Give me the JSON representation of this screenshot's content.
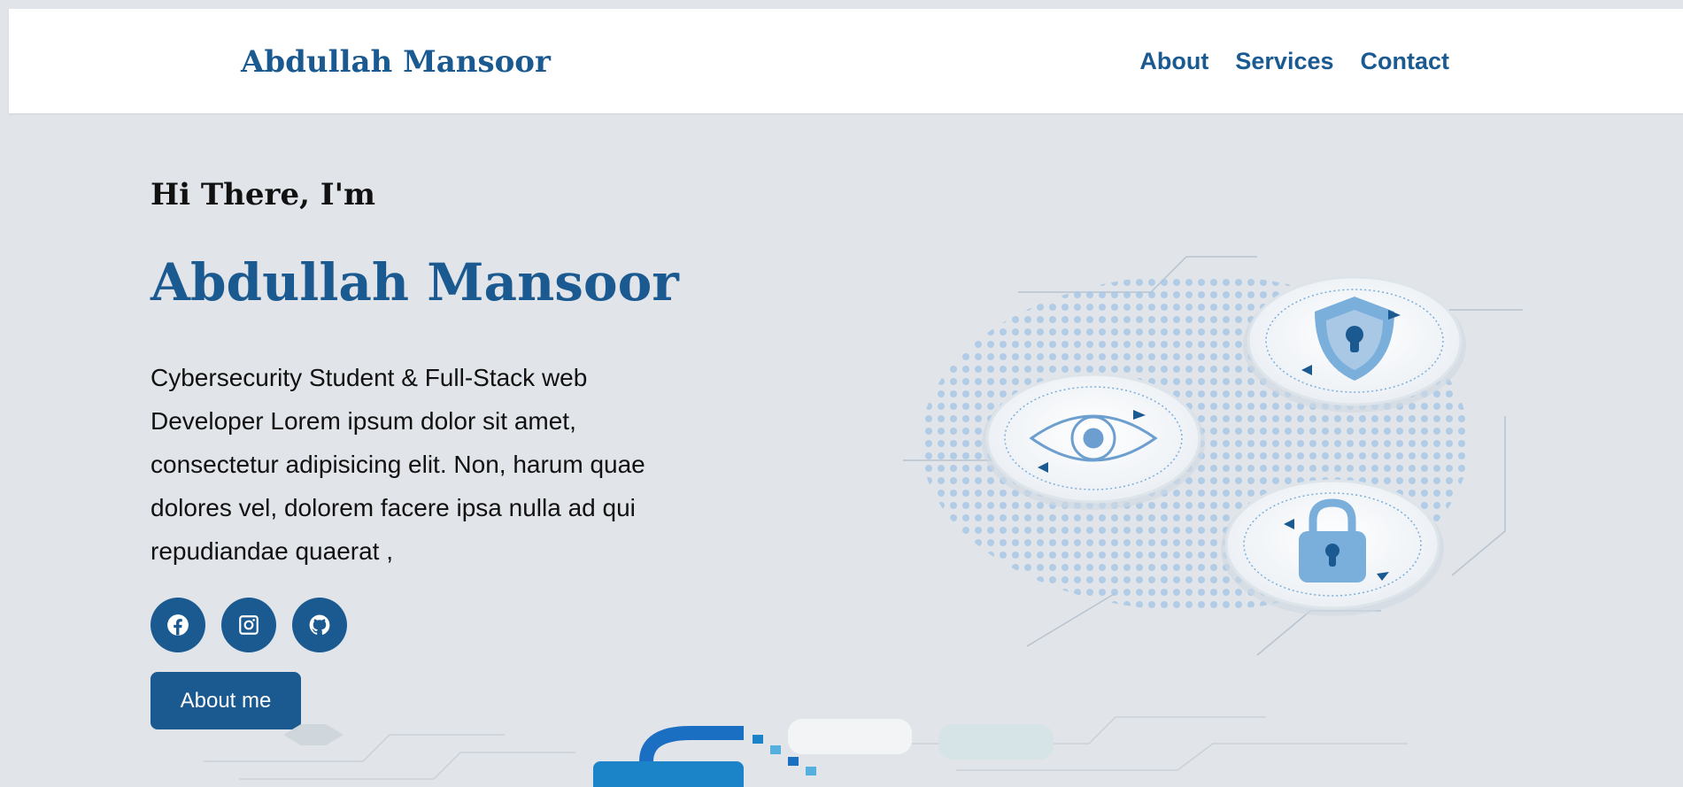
{
  "header": {
    "logo": "Abdullah Mansoor",
    "nav": [
      "About",
      "Services",
      "Contact"
    ]
  },
  "hero": {
    "greeting": "Hi There, I'm",
    "name": "Abdullah Mansoor",
    "description": "Cybersecurity Student & Full-Stack web Developer Lorem ipsum dolor sit amet, consectetur adipisicing elit. Non, harum quae dolores vel, dolorem facere ipsa nulla ad qui repudiandae quaerat ,",
    "socials": [
      "facebook-icon",
      "instagram-icon",
      "github-icon"
    ],
    "cta_label": "About me"
  },
  "illustration": {
    "badges": [
      "eye-icon",
      "shield-icon",
      "lock-icon"
    ]
  },
  "colors": {
    "accent": "#1a5a91",
    "background": "#e1e4e8",
    "illustration_blue": "#7aaedb"
  }
}
